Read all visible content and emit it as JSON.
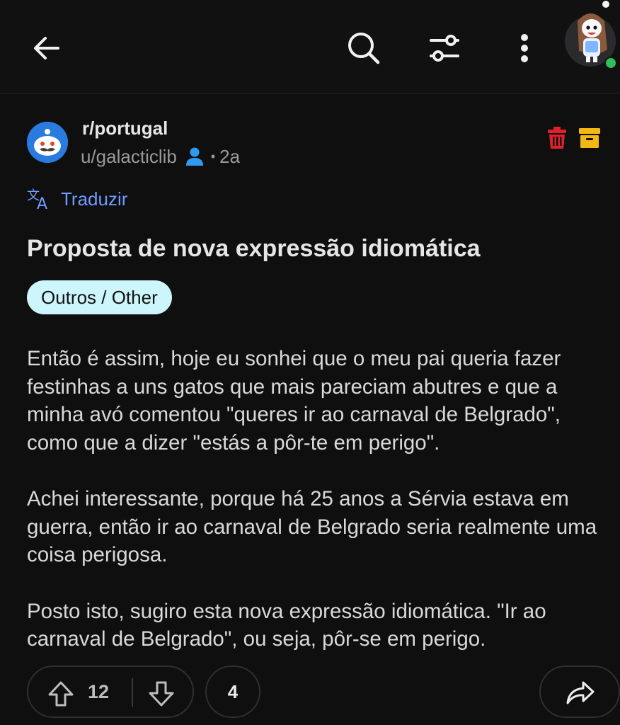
{
  "header": {
    "back_icon": "arrow-left-icon",
    "search_icon": "search-icon",
    "filter_icon": "sliders-icon",
    "more_icon": "more-vertical-icon",
    "avatar_icon": "user-avatar"
  },
  "post": {
    "subreddit": "r/portugal",
    "author": "u/galacticlib",
    "separator": "•",
    "age": "2a",
    "translate_label": "Traduzir",
    "title": "Proposta de nova expressão idiomática",
    "flair": "Outros / Other",
    "body": [
      "Então é assim, hoje eu sonhei que o meu pai queria fazer festinhas a uns gatos que mais pareciam abutres e que a minha avó comentou \"queres ir ao carnaval de Belgrado\", como que a dizer \"estás a pôr-te em perigo\".",
      "Achei interessante, porque há 25 anos a Sérvia estava em guerra, então ir ao carnaval de Belgrado seria realmente uma coisa perigosa.",
      "Posto isto, sugiro esta nova expressão idiomática. \"Ir ao carnaval de Belgrado\", ou seja, pôr-se em perigo."
    ]
  },
  "actions": {
    "votes": "12",
    "comments": "4"
  },
  "colors": {
    "background": "#0f0f10",
    "flair_bg": "#cdf6fc",
    "translate": "#6f9cff",
    "delete": "#e0202a",
    "archive": "#f3b813",
    "online": "#2fbf5a"
  }
}
